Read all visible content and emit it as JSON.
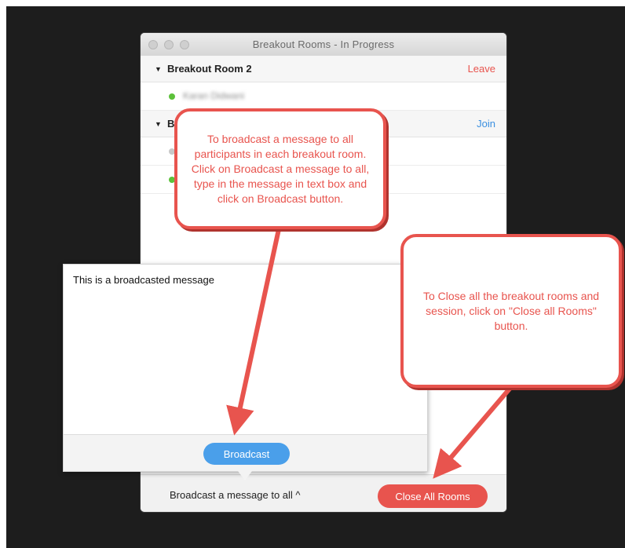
{
  "window": {
    "title": "Breakout Rooms - In Progress"
  },
  "rooms": [
    {
      "name": "Breakout Room 2",
      "action": "Leave",
      "action_color": "#e8544e",
      "participants": [
        {
          "name": "Karan Didwani",
          "status_color": "#5cc13a"
        }
      ]
    },
    {
      "name": "B",
      "action": "Join",
      "action_color": "#3a8fe0",
      "participants": [
        {
          "status_color": "#c8c8c8"
        },
        {
          "status_color": "#5cc13a"
        }
      ]
    }
  ],
  "broadcast_popup": {
    "message": "This is a broadcasted message",
    "button_label": "Broadcast"
  },
  "bottom_bar": {
    "broadcast_toggle": "Broadcast a message to all ^",
    "close_button": "Close All Rooms"
  },
  "callouts": {
    "broadcast": "To broadcast a message to all participants in each breakout room. Click on Broadcast a message to all, type in the message in text box and click on Broadcast button.",
    "close": "To Close all the breakout rooms and session, click on \"Close all Rooms\" button."
  },
  "colors": {
    "accent_red": "#e8544e",
    "accent_blue": "#4a9fea",
    "background": "#1d1d1d"
  }
}
